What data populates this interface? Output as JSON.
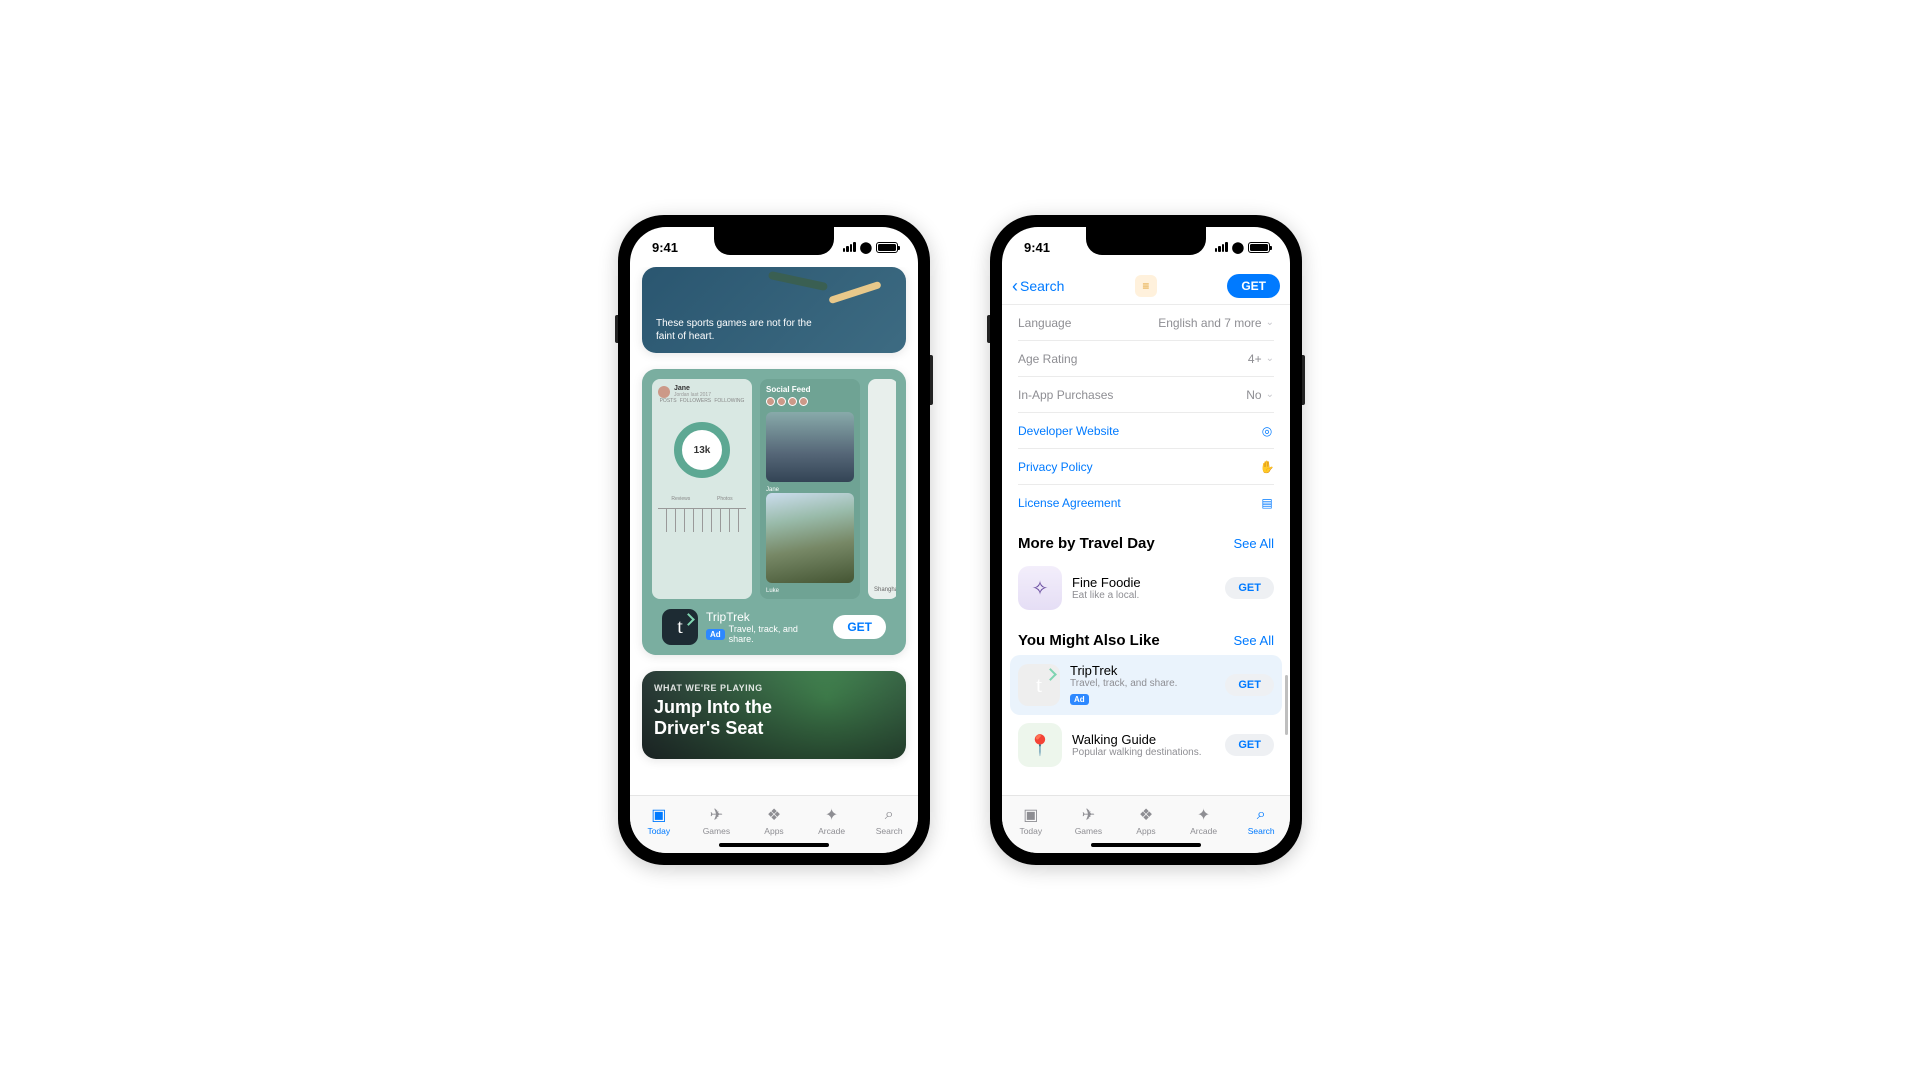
{
  "status": {
    "time": "9:41"
  },
  "tabs": {
    "today": "Today",
    "games": "Games",
    "apps": "Apps",
    "arcade": "Arcade",
    "search": "Search"
  },
  "left": {
    "sports_card": {
      "caption": "These sports games are not for the faint of heart."
    },
    "ad": {
      "shot1": {
        "name": "Jane",
        "subtitle": "Jordan last 2017",
        "metric": "13k",
        "cols": [
          "Reviews",
          "Photos"
        ]
      },
      "shot2": {
        "title": "Social Feed",
        "caption1": "Jane",
        "caption2": "Luke"
      },
      "shot3": {
        "label": "Shanghai"
      },
      "app": {
        "name": "TripTrek",
        "subtitle": "Travel, track, and share.",
        "ad_badge": "Ad",
        "get": "GET"
      }
    },
    "playing": {
      "eyebrow": "WHAT WE'RE PLAYING",
      "headline1": "Jump Into the",
      "headline2": "Driver's Seat"
    }
  },
  "right": {
    "nav": {
      "back": "Search",
      "get": "GET"
    },
    "info": [
      {
        "k": "Language",
        "v": "English and 7 more",
        "expand": true
      },
      {
        "k": "Age Rating",
        "v": "4+",
        "expand": true
      },
      {
        "k": "In-App Purchases",
        "v": "No",
        "expand": true
      }
    ],
    "links": [
      {
        "k": "Developer Website",
        "icon": "compass"
      },
      {
        "k": "Privacy Policy",
        "icon": "hand"
      },
      {
        "k": "License Agreement",
        "icon": "doc"
      }
    ],
    "more_by": {
      "title": "More by Travel Day",
      "see_all": "See All",
      "apps": [
        {
          "name": "Fine Foodie",
          "sub": "Eat like a local.",
          "get": "GET"
        }
      ]
    },
    "also_like": {
      "title": "You Might Also Like",
      "see_all": "See All",
      "apps": [
        {
          "name": "TripTrek",
          "sub": "Travel, track, and share.",
          "ad": "Ad",
          "get": "GET"
        },
        {
          "name": "Walking Guide",
          "sub": "Popular walking destinations.",
          "get": "GET"
        }
      ]
    }
  }
}
